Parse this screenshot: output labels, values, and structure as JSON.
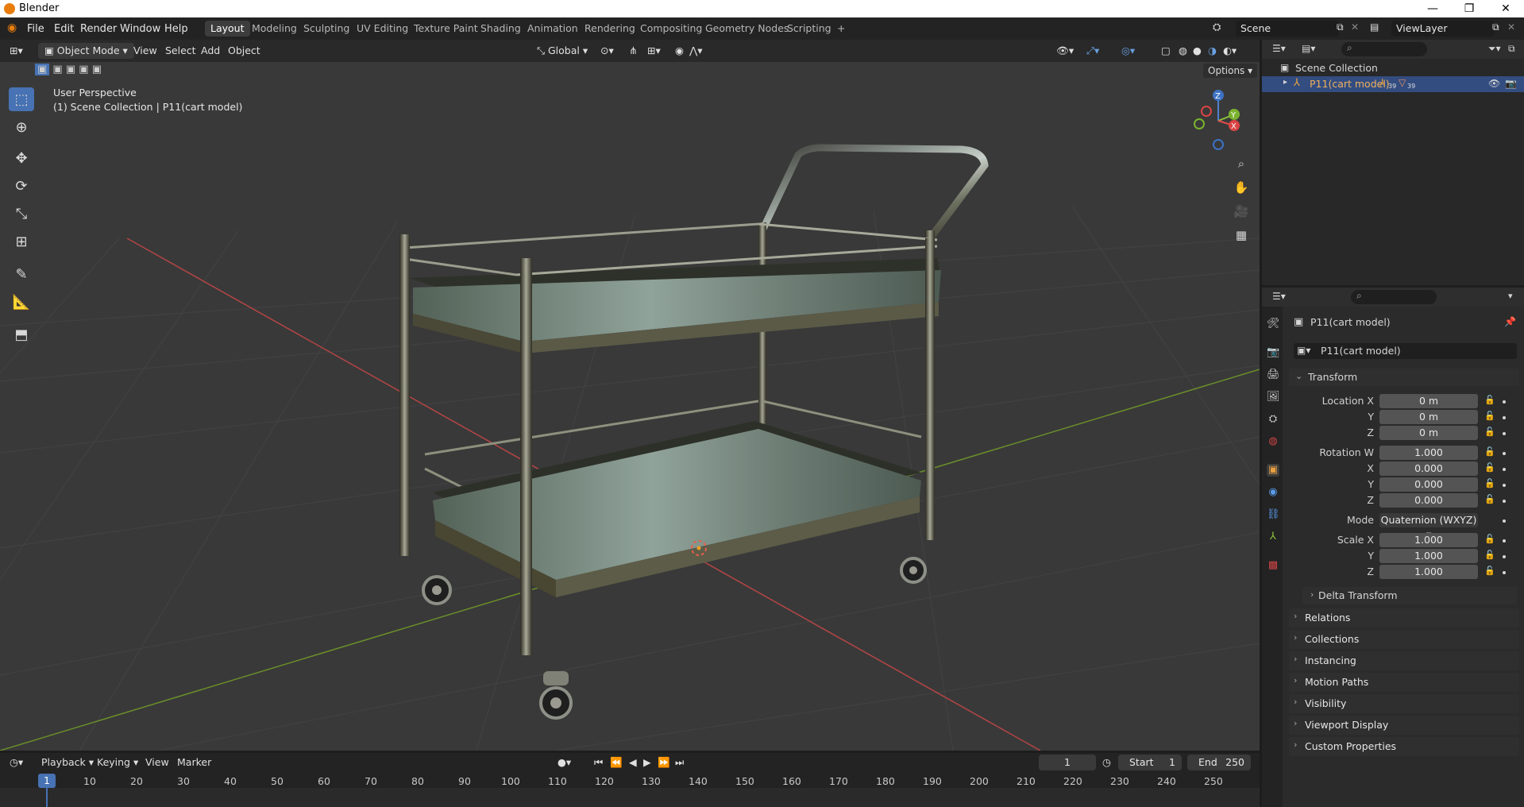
{
  "app": {
    "title": "Blender"
  },
  "window_controls": {
    "minimize": "—",
    "restore": "❐",
    "close": "✕"
  },
  "menu": [
    "File",
    "Edit",
    "Render",
    "Window",
    "Help"
  ],
  "workspaces": [
    "Layout",
    "Modeling",
    "Sculpting",
    "UV Editing",
    "Texture Paint",
    "Shading",
    "Animation",
    "Rendering",
    "Compositing",
    "Geometry Nodes",
    "Scripting"
  ],
  "workspace_add": "+",
  "scene": {
    "name": "Scene",
    "view_layer": "ViewLayer"
  },
  "viewport": {
    "mode": "Object Mode",
    "menus": [
      "View",
      "Select",
      "Add",
      "Object"
    ],
    "orientation": "Global",
    "options": "Options",
    "overlay_title": "User Perspective",
    "overlay_subtitle": "(1) Scene Collection | P11(cart model)",
    "gizmo": {
      "z": "Z",
      "y": "Y",
      "x": "X"
    },
    "colors": {
      "bg": "#393939",
      "axis_x": "#b54545",
      "axis_y": "#6b8f2a",
      "active_tool": "#4772b3"
    }
  },
  "outliner": {
    "collection": "Scene Collection",
    "object": "P11(cart model)",
    "counts": {
      "modifiers": "39",
      "meshes": "39"
    }
  },
  "properties": {
    "object_name": "P11(cart model)",
    "data_name": "P11(cart model)",
    "transform_title": "Transform",
    "location": {
      "label_x": "Location X",
      "label_y": "Y",
      "label_z": "Z",
      "x": "0 m",
      "y": "0 m",
      "z": "0 m"
    },
    "rotation": {
      "label_w": "Rotation W",
      "label_x": "X",
      "label_y": "Y",
      "label_z": "Z",
      "w": "1.000",
      "x": "0.000",
      "y": "0.000",
      "z": "0.000"
    },
    "mode": {
      "label": "Mode",
      "value": "Quaternion (WXYZ)"
    },
    "scale": {
      "label_x": "Scale X",
      "label_y": "Y",
      "label_z": "Z",
      "x": "1.000",
      "y": "1.000",
      "z": "1.000"
    },
    "delta": "Delta Transform",
    "panels": [
      "Relations",
      "Collections",
      "Instancing",
      "Motion Paths",
      "Visibility",
      "Viewport Display",
      "Custom Properties"
    ]
  },
  "timeline": {
    "menus": [
      "Playback",
      "Keying",
      "View",
      "Marker"
    ],
    "current_frame": "1",
    "start_label": "Start",
    "start": "1",
    "end_label": "End",
    "end": "250",
    "ruler": [
      "1",
      "10",
      "20",
      "30",
      "40",
      "50",
      "60",
      "70",
      "80",
      "90",
      "100",
      "110",
      "120",
      "130",
      "140",
      "150",
      "160",
      "170",
      "180",
      "190",
      "200",
      "210",
      "220",
      "230",
      "240",
      "250"
    ]
  }
}
